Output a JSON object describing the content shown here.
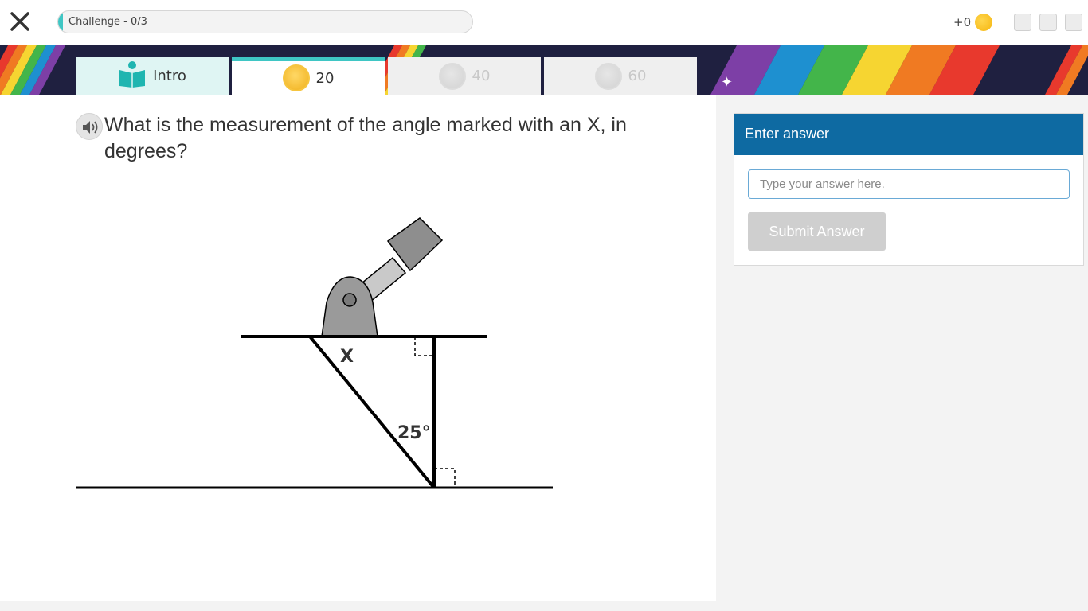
{
  "header": {
    "progress_label": "Challenge - 0/3",
    "progress_fraction": 0.01,
    "coins_text": "+0",
    "close_icon": "close-icon",
    "coin_icon": "coin-icon"
  },
  "tabs": [
    {
      "label": "Intro",
      "icon": "book-icon",
      "state": "done"
    },
    {
      "label": "20",
      "icon": "gold-medal-icon",
      "state": "active"
    },
    {
      "label": "40",
      "icon": "grey-medal-icon",
      "state": "locked"
    },
    {
      "label": "60",
      "icon": "grey-medal-icon",
      "state": "locked"
    }
  ],
  "question": {
    "text": "What is the measurement of the angle marked with an X, in degrees?",
    "audio_icon": "speaker-icon"
  },
  "diagram": {
    "angle_x_label": "X",
    "angle_given_label": "25°"
  },
  "answer_panel": {
    "title": "Enter answer",
    "input_placeholder": "Type your answer here.",
    "input_value": "",
    "submit_label": "Submit Answer"
  },
  "colors": {
    "accent_teal": "#3fc6c4",
    "panel_blue": "#0e6aa2",
    "submit_disabled": "#cfcfcf",
    "banner_dark": "#1f2040"
  }
}
